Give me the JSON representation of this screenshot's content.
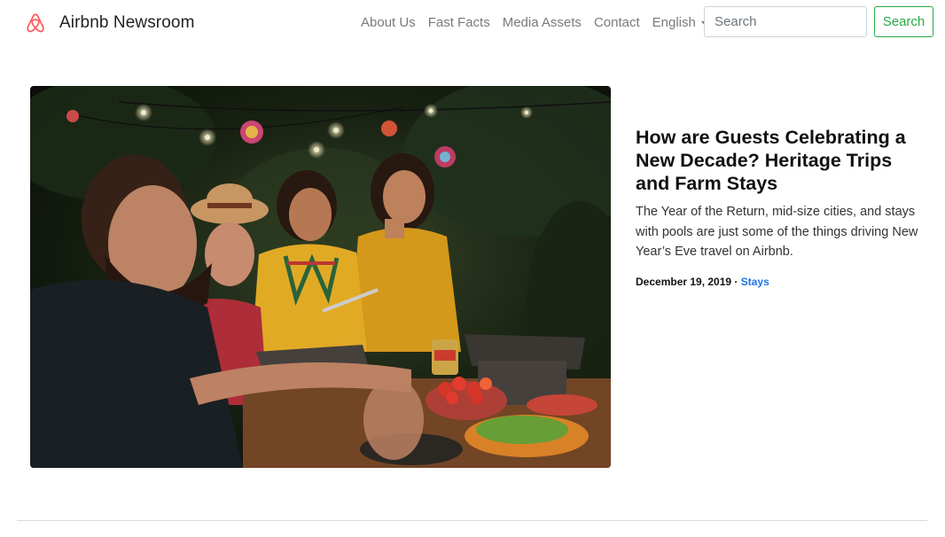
{
  "header": {
    "brand": "Airbnb Newsroom",
    "nav": [
      "About Us",
      "Fast Facts",
      "Media Assets",
      "Contact"
    ],
    "language": "English",
    "search_placeholder": "Search",
    "search_button": "Search"
  },
  "featured": {
    "title": "How are Guests Celebrating a New Decade? Heritage Trips and Farm Stays",
    "summary": "The Year of the Return, mid-size cities, and stays with pools are just some of the things driving New Year’s Eve travel on Airbnb.",
    "date": "December 19, 2019",
    "separator": " · ",
    "category": "Stays"
  },
  "colors": {
    "brand_logo": "#ff5a5f",
    "nav_link": "#7a7a7a",
    "search_button": "#28a745",
    "category_link": "#1a73e8"
  },
  "icons": {
    "brand": "airbnb-logo-icon",
    "language_caret": "caret-down-icon"
  }
}
